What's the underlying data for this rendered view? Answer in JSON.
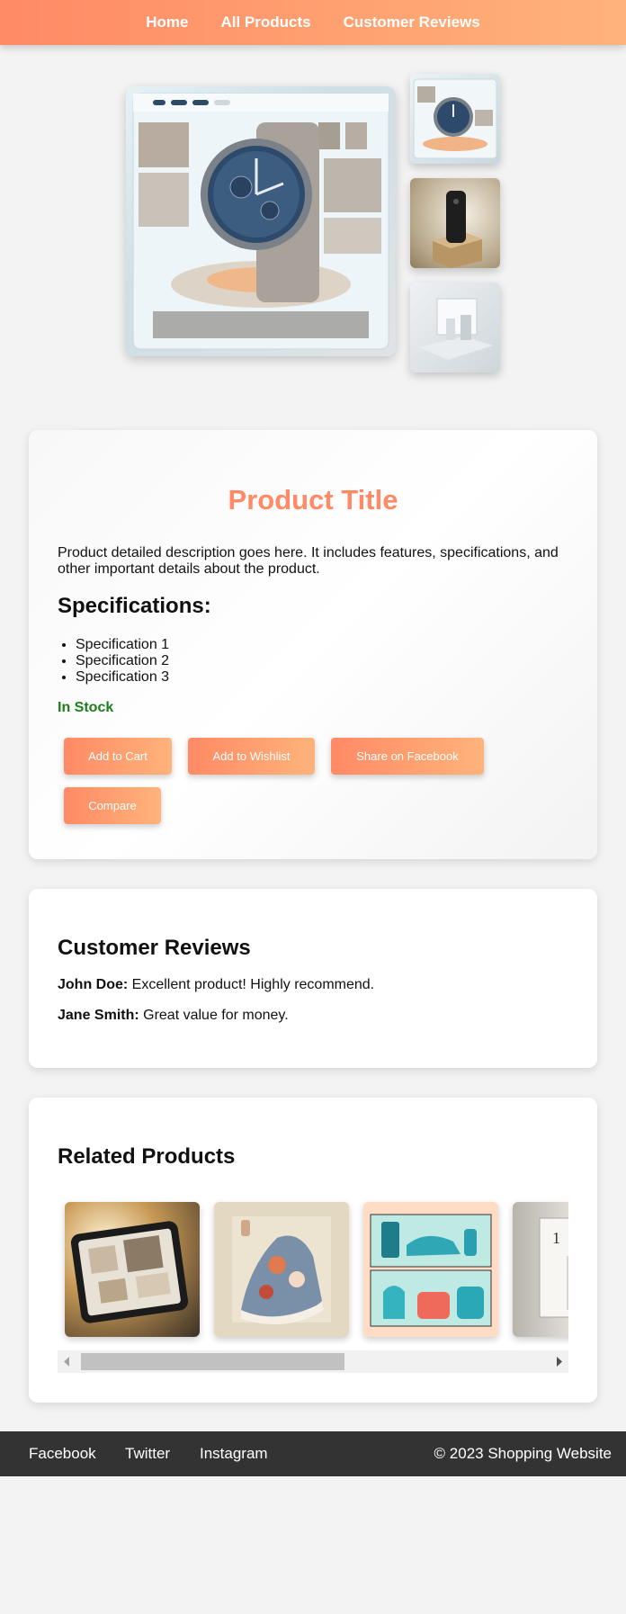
{
  "nav": {
    "home": "Home",
    "all_products": "All Products",
    "customer_reviews": "Customer Reviews"
  },
  "product": {
    "title": "Product Title",
    "description": "Product detailed description goes here. It includes features, specifications, and other important details about the product.",
    "spec_heading": "Specifications:",
    "specs": [
      "Specification 1",
      "Specification 2",
      "Specification 3"
    ],
    "stock": "In Stock",
    "buttons": {
      "add_to_cart": "Add to Cart",
      "add_to_wishlist": "Add to Wishlist",
      "share_facebook": "Share on Facebook",
      "compare": "Compare"
    }
  },
  "reviews": {
    "heading": "Customer Reviews",
    "items": [
      {
        "name": "John Doe:",
        "text": " Excellent product! Highly recommend."
      },
      {
        "name": "Jane Smith:",
        "text": " Great value for money."
      }
    ]
  },
  "related": {
    "heading": "Related Products",
    "partial_item_label": "1"
  },
  "footer": {
    "facebook": "Facebook",
    "twitter": "Twitter",
    "instagram": "Instagram",
    "copyright": "© 2023 Shopping Website"
  },
  "colors": {
    "accent": "#ff8a65",
    "accent_light": "#ffb37a",
    "stock_green": "#1a7f1a",
    "footer_bg": "#333333"
  }
}
